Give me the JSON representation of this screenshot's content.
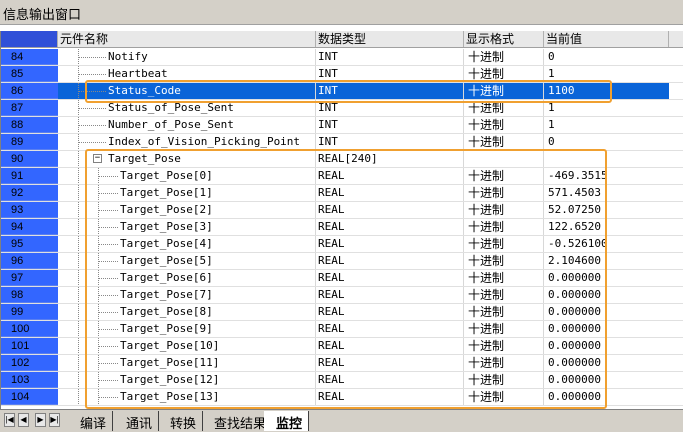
{
  "window": {
    "title": "信息输出窗口"
  },
  "columns": {
    "name": "元件名称",
    "type": "数据类型",
    "format": "显示格式",
    "value": "当前值"
  },
  "rows": [
    {
      "num": "84",
      "name": "Notify",
      "type": "INT",
      "format": "十进制",
      "value": "0"
    },
    {
      "num": "85",
      "name": "Heartbeat",
      "type": "INT",
      "format": "十进制",
      "value": "1"
    },
    {
      "num": "86",
      "name": "Status_Code",
      "type": "INT",
      "format": "十进制",
      "value": "1100"
    },
    {
      "num": "87",
      "name": "Status_of_Pose_Sent",
      "type": "INT",
      "format": "十进制",
      "value": "1"
    },
    {
      "num": "88",
      "name": "Number_of_Pose_Sent",
      "type": "INT",
      "format": "十进制",
      "value": "1"
    },
    {
      "num": "89",
      "name": "Index_of_Vision_Picking_Point",
      "type": "INT",
      "format": "十进制",
      "value": "0"
    },
    {
      "num": "90",
      "name": "Target_Pose",
      "type": "REAL[240]",
      "format": "",
      "value": ""
    },
    {
      "num": "91",
      "name": "Target_Pose[0]",
      "type": "REAL",
      "format": "十进制",
      "value": "-469.3515"
    },
    {
      "num": "92",
      "name": "Target_Pose[1]",
      "type": "REAL",
      "format": "十进制",
      "value": "571.4503"
    },
    {
      "num": "93",
      "name": "Target_Pose[2]",
      "type": "REAL",
      "format": "十进制",
      "value": "52.07250"
    },
    {
      "num": "94",
      "name": "Target_Pose[3]",
      "type": "REAL",
      "format": "十进制",
      "value": "122.6520"
    },
    {
      "num": "95",
      "name": "Target_Pose[4]",
      "type": "REAL",
      "format": "十进制",
      "value": "-0.526100"
    },
    {
      "num": "96",
      "name": "Target_Pose[5]",
      "type": "REAL",
      "format": "十进制",
      "value": "2.104600"
    },
    {
      "num": "97",
      "name": "Target_Pose[6]",
      "type": "REAL",
      "format": "十进制",
      "value": "0.000000"
    },
    {
      "num": "98",
      "name": "Target_Pose[7]",
      "type": "REAL",
      "format": "十进制",
      "value": "0.000000"
    },
    {
      "num": "99",
      "name": "Target_Pose[8]",
      "type": "REAL",
      "format": "十进制",
      "value": "0.000000"
    },
    {
      "num": "100",
      "name": "Target_Pose[9]",
      "type": "REAL",
      "format": "十进制",
      "value": "0.000000"
    },
    {
      "num": "101",
      "name": "Target_Pose[10]",
      "type": "REAL",
      "format": "十进制",
      "value": "0.000000"
    },
    {
      "num": "102",
      "name": "Target_Pose[11]",
      "type": "REAL",
      "format": "十进制",
      "value": "0.000000"
    },
    {
      "num": "103",
      "name": "Target_Pose[12]",
      "type": "REAL",
      "format": "十进制",
      "value": "0.000000"
    },
    {
      "num": "104",
      "name": "Target_Pose[13]",
      "type": "REAL",
      "format": "十进制",
      "value": "0.000000"
    }
  ],
  "tabs": [
    {
      "label": "编译",
      "active": false
    },
    {
      "label": "通讯",
      "active": false
    },
    {
      "label": "转换",
      "active": false
    },
    {
      "label": "查找结果",
      "active": false
    },
    {
      "label": "监控",
      "active": true
    }
  ],
  "expander_symbol": "−",
  "nav_icons": [
    "first-icon",
    "prev-icon",
    "next-icon",
    "last-icon"
  ],
  "colors": {
    "row_number_bg": "#3366ff",
    "selection": "#0a64d8",
    "highlight_box": "#f0a030"
  }
}
